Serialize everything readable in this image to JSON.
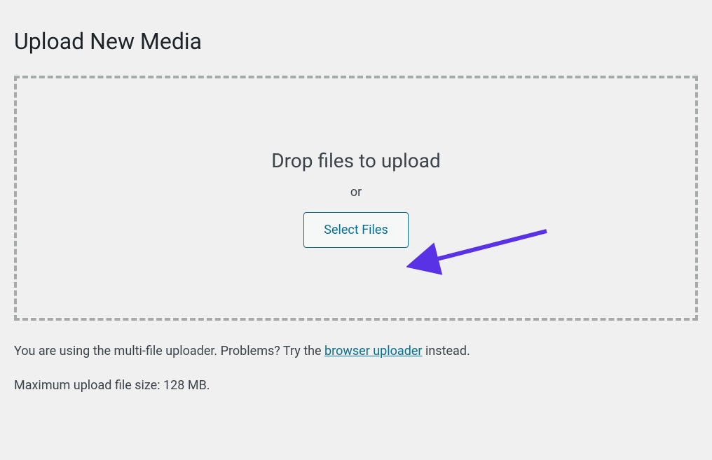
{
  "page": {
    "title": "Upload New Media"
  },
  "dropzone": {
    "drop_text": "Drop files to upload",
    "or_text": "or",
    "button_label": "Select Files"
  },
  "info": {
    "prefix": "You are using the multi-file uploader. Problems? Try the ",
    "link_label": "browser uploader",
    "suffix": " instead.",
    "max_size": "Maximum upload file size: 128 MB."
  },
  "annotation": {
    "arrow_color": "#5a32e6"
  }
}
